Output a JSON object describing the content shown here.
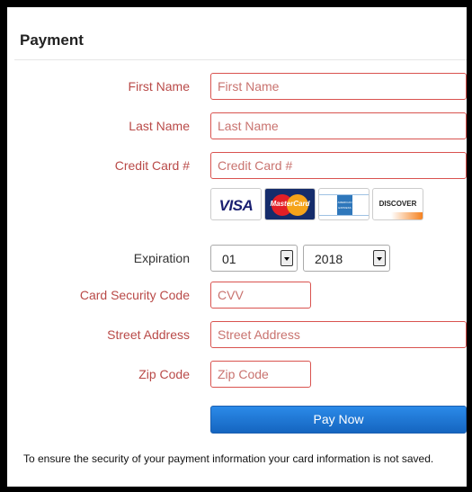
{
  "title": "Payment",
  "fields": {
    "first_name": {
      "label": "First Name",
      "placeholder": "First Name",
      "value": ""
    },
    "last_name": {
      "label": "Last Name",
      "placeholder": "Last Name",
      "value": ""
    },
    "credit_card": {
      "label": "Credit Card #",
      "placeholder": "Credit Card #",
      "value": ""
    },
    "cvv": {
      "label": "Card Security Code",
      "placeholder": "CVV",
      "value": ""
    },
    "street": {
      "label": "Street Address",
      "placeholder": "Street Address",
      "value": ""
    },
    "zip": {
      "label": "Zip Code",
      "placeholder": "Zip Code",
      "value": ""
    }
  },
  "cards": {
    "visa": "VISA",
    "mastercard": "MasterCard",
    "amex": "AMERICAN EXPRESS",
    "discover": "DISCOVER"
  },
  "expiration": {
    "label": "Expiration",
    "month": "01",
    "year": "2018"
  },
  "pay_button": "Pay Now",
  "note": "To ensure the security of your payment information your card information is not saved.",
  "colors": {
    "error": "#b94a48",
    "field_border": "#d9534f",
    "button": "#1f78d1"
  }
}
